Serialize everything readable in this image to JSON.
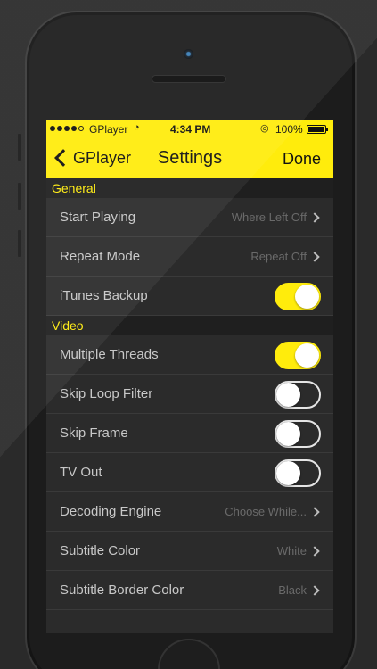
{
  "status": {
    "carrier": "GPlayer",
    "wifi_icon": "wifi-icon",
    "time": "4:34 PM",
    "lock_icon": "rotation-lock-icon",
    "battery": "100%"
  },
  "nav": {
    "back_label": "GPlayer",
    "title": "Settings",
    "done_label": "Done"
  },
  "sections": {
    "general": {
      "header": "General",
      "rows": [
        {
          "label": "Start Playing",
          "value": "Where Left Off"
        },
        {
          "label": "Repeat Mode",
          "value": "Repeat Off"
        },
        {
          "label": "iTunes Backup",
          "toggle": true
        }
      ]
    },
    "video": {
      "header": "Video",
      "rows": [
        {
          "label": "Multiple Threads",
          "toggle": true
        },
        {
          "label": "Skip Loop Filter",
          "toggle": false
        },
        {
          "label": "Skip Frame",
          "toggle": false
        },
        {
          "label": "TV Out",
          "toggle": false
        },
        {
          "label": "Decoding Engine",
          "value": "Choose While..."
        },
        {
          "label": "Subtitle Color",
          "value": "White"
        },
        {
          "label": "Subtitle Border Color",
          "value": "Black"
        }
      ]
    }
  },
  "colors": {
    "accent": "#ffec0c",
    "background": "#2b2b2b"
  }
}
